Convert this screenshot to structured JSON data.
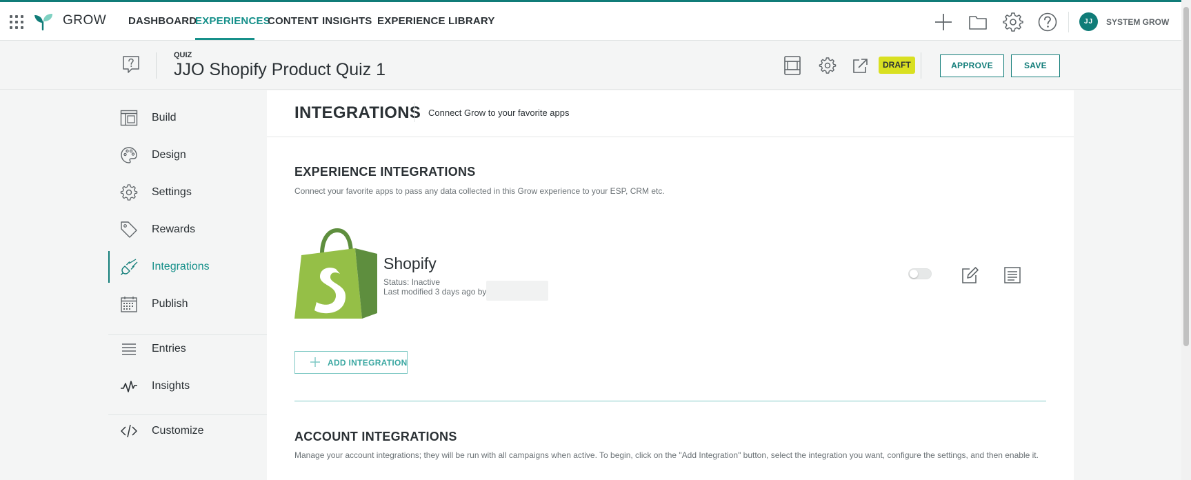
{
  "topbar": {
    "brand": "GROW",
    "nav": [
      {
        "label": "DASHBOARD",
        "active": false
      },
      {
        "label": "EXPERIENCES",
        "active": true
      },
      {
        "label": "CONTENT",
        "active": false
      },
      {
        "label": "INSIGHTS",
        "active": false
      },
      {
        "label": "EXPERIENCE LIBRARY",
        "active": false
      }
    ],
    "actions": [
      "plus-icon",
      "folder-icon",
      "gear-icon",
      "help-icon"
    ],
    "user": {
      "initials": "JJ",
      "name": "SYSTEM GROW"
    }
  },
  "header": {
    "experience_type": "QUIZ",
    "title": "JJO Shopify Product Quiz 1",
    "icons": [
      "preview-icon",
      "settings-icon",
      "external-link-icon"
    ],
    "status_badge": "DRAFT",
    "approve_label": "APPROVE",
    "save_label": "SAVE"
  },
  "sidebar": {
    "items": [
      {
        "label": "Build",
        "icon": "layout-icon",
        "active": false
      },
      {
        "label": "Design",
        "icon": "palette-icon",
        "active": false
      },
      {
        "label": "Settings",
        "icon": "gear-icon",
        "active": false
      },
      {
        "label": "Rewards",
        "icon": "tag-icon",
        "active": false
      },
      {
        "label": "Integrations",
        "icon": "plug-icon",
        "active": true
      },
      {
        "label": "Publish",
        "icon": "calendar-icon",
        "active": false
      },
      {
        "label": "Entries",
        "icon": "list-icon",
        "active": false
      },
      {
        "label": "Insights",
        "icon": "pulse-icon",
        "active": false
      },
      {
        "label": "Customize",
        "icon": "code-icon",
        "active": false
      }
    ]
  },
  "main": {
    "title": "INTEGRATIONS",
    "subtitle": "Connect Grow to your favorite apps",
    "experience_integrations": {
      "title": "EXPERIENCE INTEGRATIONS",
      "description": "Connect your favorite apps to pass any data collected in this Grow experience to your ESP, CRM etc.",
      "items": [
        {
          "name": "Shopify",
          "status": "Status: Inactive",
          "modified": "Last modified 3 days ago by",
          "enabled": false
        }
      ],
      "add_label": "ADD INTEGRATION"
    },
    "account_integrations": {
      "title": "ACCOUNT INTEGRATIONS",
      "description": "Manage your account integrations; they will be run with all campaigns when active. To begin, click on the \"Add Integration\" button, select the integration you want, configure the settings, and then enable it."
    }
  },
  "colors": {
    "accent": "#107c78",
    "accent_light": "#16908a",
    "draft": "#d9e021",
    "shopify_green": "#95bf47",
    "shopify_dark": "#5e8e3e"
  }
}
